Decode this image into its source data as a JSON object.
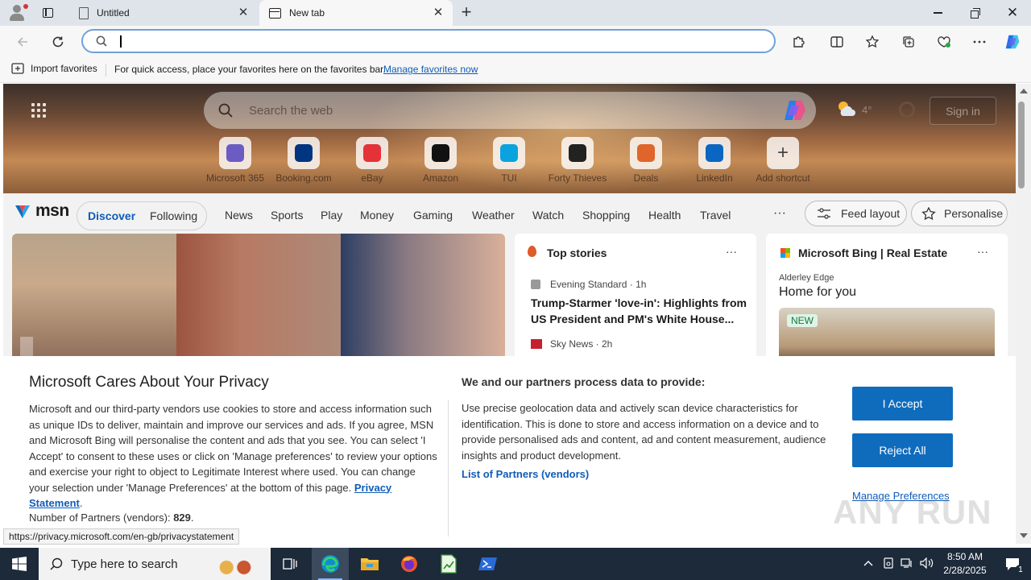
{
  "tabs": [
    {
      "label": "Untitled"
    },
    {
      "label": "New tab"
    }
  ],
  "address": {
    "value": "",
    "placeholder": ""
  },
  "favorites_bar": {
    "import_label": "Import favorites",
    "message": "For quick access, place your favorites here on the favorites bar.",
    "link": "Manage favorites now"
  },
  "search": {
    "placeholder": "Search the web"
  },
  "weather_temp": "4°",
  "sign_in": "Sign in",
  "shortcuts": [
    {
      "label": "Microsoft 365",
      "icon": "microsoft-365-icon",
      "color": "#6b5cc4"
    },
    {
      "label": "Booking.com",
      "icon": "booking-icon",
      "color": "#003580"
    },
    {
      "label": "eBay",
      "icon": "ebay-icon",
      "color": "#e53238"
    },
    {
      "label": "Amazon",
      "icon": "amazon-icon",
      "color": "#111111"
    },
    {
      "label": "TUI",
      "icon": "tui-icon",
      "color": "#0aa3e0"
    },
    {
      "label": "Forty Thieves",
      "icon": "forty-thieves-icon",
      "color": "#222222"
    },
    {
      "label": "Deals",
      "icon": "deals-icon",
      "color": "#e0652b"
    },
    {
      "label": "LinkedIn",
      "icon": "linkedin-icon",
      "color": "#0a66c2"
    },
    {
      "label": "Add shortcut",
      "icon": "plus-icon",
      "color": "#444444"
    }
  ],
  "msn": {
    "logo": "msn",
    "discover": "Discover",
    "following": "Following",
    "nav": [
      "News",
      "Sports",
      "Play",
      "Money",
      "Gaming",
      "Weather",
      "Watch",
      "Shopping",
      "Health",
      "Travel"
    ],
    "more": "···",
    "feed_layout": "Feed layout",
    "personalise": "Personalise"
  },
  "top_stories": {
    "title": "Top stories",
    "items": [
      {
        "source": "Evening Standard · 1h",
        "headline": "Trump-Starmer 'love-in': Highlights from US President and PM's White House..."
      },
      {
        "source": "Sky News · 2h",
        "headline": ""
      }
    ]
  },
  "bing_card": {
    "title": "Microsoft Bing | Real Estate",
    "location": "Alderley Edge",
    "heading": "Home for you",
    "badge": "NEW"
  },
  "consent": {
    "title": "Microsoft Cares About Your Privacy",
    "body": "Microsoft and our third-party vendors use cookies to store and access information such as unique IDs to deliver, maintain and improve our services and ads. If you agree, MSN and Microsoft Bing will personalise the content and ads that you see. You can select 'I Accept' to consent to these uses or click on 'Manage preferences' to review your options and exercise your right to object to Legitimate Interest where used.  You can change your selection under 'Manage Preferences' at the bottom of this page.",
    "privacy_link": "Privacy Statement",
    "partners_label": "Number of Partners (vendors):",
    "partners_count": "829",
    "right_title": "We and our partners process data to provide:",
    "right_body": "Use precise geolocation data and actively scan device characteristics for identification. This is done to store and access information on a device and to provide personalised ads and content, ad and content measurement, audience insights and product development.",
    "list_partners": "List of Partners (vendors)",
    "accept": "I Accept",
    "reject": "Reject All",
    "manage": "Manage Preferences"
  },
  "status_url": "https://privacy.microsoft.com/en-gb/privacystatement",
  "watermark": "ANY RUN",
  "taskbar": {
    "search_placeholder": "Type here to search",
    "time": "8:50 AM",
    "date": "2/28/2025",
    "notification_count": "1"
  }
}
